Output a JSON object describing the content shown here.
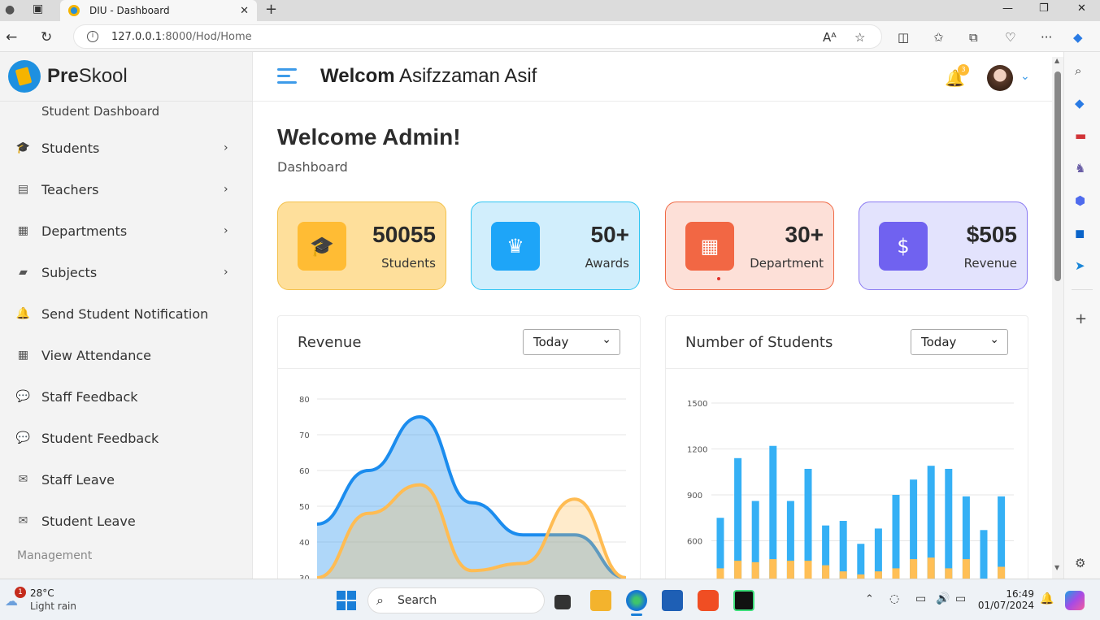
{
  "browser": {
    "tab_title": "DIU - Dashboard",
    "url_host": "127.0.0.1",
    "url_rest": ":8000/Hod/Home"
  },
  "sidebar": {
    "logo_bold": "Pre",
    "logo_rest": "Skool",
    "top_item": "Student Dashboard",
    "items": [
      {
        "label": "Students",
        "icon": "graduate-icon",
        "arrow": true
      },
      {
        "label": "Teachers",
        "icon": "chalkboard-teacher-icon",
        "arrow": true
      },
      {
        "label": "Departments",
        "icon": "building-icon",
        "arrow": true
      },
      {
        "label": "Subjects",
        "icon": "book-reader-icon",
        "arrow": true
      },
      {
        "label": "Send Student Notification",
        "icon": "bell-icon",
        "arrow": false
      },
      {
        "label": "View Attendance",
        "icon": "calendar-icon",
        "arrow": false
      },
      {
        "label": "Staff Feedback",
        "icon": "comments-icon",
        "arrow": false
      },
      {
        "label": "Student Feedback",
        "icon": "comments-icon",
        "arrow": false
      },
      {
        "label": "Staff Leave",
        "icon": "envelope-icon",
        "arrow": false
      },
      {
        "label": "Student Leave",
        "icon": "envelope-icon",
        "arrow": false
      }
    ],
    "section_label": "Management"
  },
  "header": {
    "welcome_bold": "Welcom",
    "welcome_name": "Asifzzaman Asif",
    "notification_count": "3"
  },
  "page": {
    "title": "Welcome Admin!",
    "subtitle": "Dashboard"
  },
  "cards": [
    {
      "value": "50055",
      "label": "Students",
      "bg": "#fedf9b",
      "border": "#f3c14c",
      "icon_bg": "#ffbc34",
      "icon": "graduate-icon"
    },
    {
      "value": "50+",
      "label": "Awards",
      "bg": "#d1eefc",
      "border": "#2ec5f2",
      "icon_bg": "#1ea5f8",
      "icon": "crown-icon"
    },
    {
      "value": "30+",
      "label": "Department",
      "bg": "#fde0d8",
      "border": "#f06a46",
      "icon_bg": "#f26744",
      "icon": "building-icon"
    },
    {
      "value": "$505",
      "label": "Revenue",
      "bg": "#e3e3fd",
      "border": "#8a7af2",
      "icon_bg": "#7062f0",
      "icon": "invoice-icon"
    }
  ],
  "revenue_panel": {
    "title": "Revenue",
    "select": "Today"
  },
  "students_panel": {
    "title": "Number of Students",
    "select": "Today"
  },
  "chart_data": [
    {
      "type": "area",
      "title": "Revenue",
      "y_ticks": [
        30,
        40,
        50,
        60,
        70,
        80
      ],
      "ylim": [
        30,
        80
      ],
      "series": [
        {
          "color": "#1b8cee",
          "values": [
            45,
            60,
            75,
            51,
            42,
            42,
            30
          ]
        },
        {
          "color": "#ffbc53",
          "values": [
            30,
            48,
            56,
            32,
            34,
            52,
            30
          ]
        }
      ]
    },
    {
      "type": "bar",
      "title": "Number of Students",
      "y_ticks": [
        600,
        900,
        1200,
        1500
      ],
      "ylim": [
        300,
        1500
      ],
      "series": [
        {
          "color": "#35b0f5",
          "values": [
            750,
            1140,
            860,
            1220,
            860,
            1070,
            700,
            730,
            580,
            680,
            900,
            1000,
            1090,
            1070,
            890,
            670,
            890
          ]
        },
        {
          "color": "#ffbf56",
          "values": [
            420,
            470,
            460,
            480,
            470,
            470,
            440,
            400,
            380,
            400,
            420,
            480,
            490,
            420,
            480,
            350,
            430
          ]
        }
      ]
    }
  ],
  "taskbar": {
    "temperature": "28°C",
    "weather": "Light rain",
    "weather_badge": "1",
    "search": "Search",
    "time": "16:49",
    "date": "01/07/2024"
  }
}
